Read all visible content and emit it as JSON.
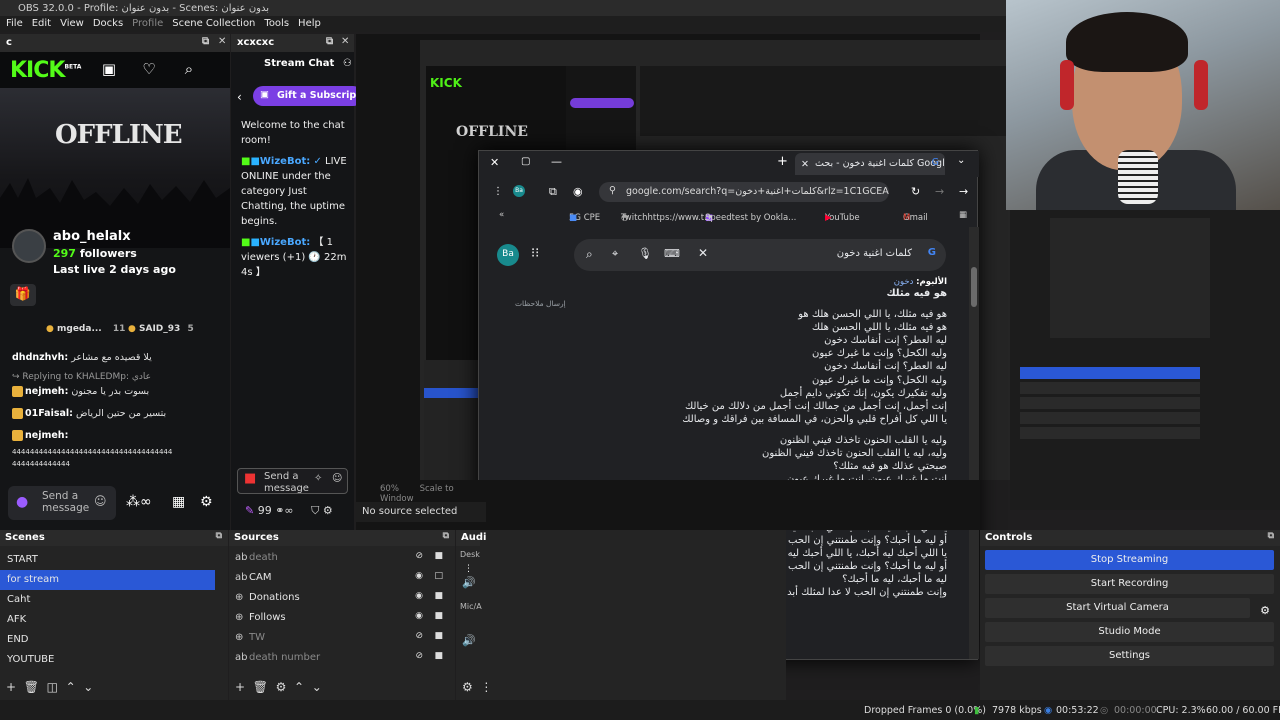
{
  "window": {
    "title": "OBS 32.0.0 - Profile: بدون عنوان - Scenes: بدون عنوان"
  },
  "menu": [
    "File",
    "Edit",
    "View",
    "Docks",
    "Profile",
    "Scene Collection",
    "Tools",
    "Help"
  ],
  "kick_dock": {
    "title": "c",
    "logo": "KICK",
    "logo_sup": "BETA",
    "offline_text": "OFFLINE",
    "streamer": "abo_helalx",
    "followers_count": "297",
    "followers_label": "followers",
    "last_live": "Last live 2 days ago",
    "leaderboard": [
      {
        "name": "mgeda...",
        "count": "11"
      },
      {
        "name": "SAID_93",
        "count": "5"
      }
    ],
    "chat": [
      {
        "user": "dhdnzhvh:",
        "text": "يلا قصيده مع مشاعر"
      },
      {
        "user": "",
        "text": "Replying to KHALEDMp: عادي"
      },
      {
        "user": "nejmeh:",
        "text": "بسوت بدر يا مجنون"
      },
      {
        "user": "01Faisal:",
        "text": "بتسير من حتين الرياض"
      },
      {
        "user": "nejmeh:",
        "text": ""
      },
      {
        "user": "",
        "text": "444444444444444444444444444444444444"
      },
      {
        "user": "",
        "text": "4444444444444"
      }
    ],
    "input_placeholder": "Send a message"
  },
  "xc_dock": {
    "title": "xcxcxc",
    "chat_title": "Stream Chat",
    "gift_label": "Gift a Subscripti",
    "welcome": "Welcome to the chat room!",
    "bot1": "WizeBot:",
    "msg1": "LIVE ONLINE under the category Just Chatting, the uptime begins.",
    "bot2": "WizeBot:",
    "msg2": "【 1 viewers (+1) 🕐 22m 4s 】",
    "input_placeholder": "Send a message",
    "points": "99"
  },
  "chrome": {
    "tab_title": "كلمات اغنية دخون - بحث Google",
    "address": "google.com/search?q=كلمات+اغنية+دخون&rlz=1C1GCEA_...",
    "bookmarks": [
      "5G CPE",
      "Twitchhttps://www.t...",
      "Speedtest by Ookla...",
      "YouTube",
      "Gmail"
    ],
    "avatar": "Ba",
    "search_text": "كلمات اغنية دخون",
    "album_label": "الألبوم:",
    "album_value": "دخون",
    "feedback": "إرسال ملاحظات",
    "lyrics": [
      "هو فيه مثلك",
      "",
      "هو فيه مثلك، يا اللي الحسن هلك هو",
      "هو فيه مثلك، يا اللي الحسن هلك",
      "ليه العطر؟ إنت أنفاسك دخون",
      "وليه الكحل؟ وإنت ما غيرك عيون",
      "ليه العطر؟ إنت أنفاسك دخون",
      "وليه الكحل؟ وإنت ما غيرك عيون",
      "وليه تفكيرك يكون، إنك تكوني دايم أجمل",
      "إنت أجمل، إنت أجمل من جمالك إنت أجمل من دلالك من خيالك",
      "يا اللي كل أفراح قلبي والحزن، في المسافة بين فراقك و وصالك",
      "",
      "وليه يا القلب الحنون تاخذك فيني الظنون",
      "وليه، ليه يا القلب الحنون تاخذك فيني الظنون",
      "صبحتي عذلك هو فيه مثلك؟",
      "إنت ما غيرك عيون، إنت ما غيرك عيون",
      "وأنا أحبك، أحبك، أحبك وإنت، وإنت أنفاسك دخون",
      "وإنت أنفاسك دخون، وإنت أنفاسك دخون",
      "",
      "يا اللي أحبك ليه أحبك، يا اللي أحبك ليه أحبك؟",
      "أو ليه ما أحبك؟ وإنت طمنتني إن الحب كله أسئلة، أسئلة ما تنتهي",
      "يا اللي أحبك ليه أحبك، يا اللي أحبك ليه أحبك؟",
      "أو ليه ما أحبك؟ وإنت طمنتني إن الحب كله أسئلة، أسئلة ما تنتهي",
      "ليه ما أحبك، ليه ما أحبك؟",
      "وإنت طمنتني إن الحب لا عدا لمثلك أبد ما ينتهي"
    ]
  },
  "preview": {
    "zoom": "60%",
    "scale": "Scale to Window",
    "no_source": "No source selected"
  },
  "scenes": {
    "title": "Scenes",
    "items": [
      "START",
      "for stream",
      "Caht",
      "AFK",
      "END",
      "YOUTUBE"
    ],
    "selected": 1
  },
  "sources": {
    "title": "Sources",
    "items": [
      {
        "name": "death",
        "visible": false
      },
      {
        "name": "CAM",
        "visible": true
      },
      {
        "name": "Donations",
        "visible": true
      },
      {
        "name": "Follows",
        "visible": true
      },
      {
        "name": "TW",
        "visible": false
      },
      {
        "name": "death number",
        "visible": false
      }
    ]
  },
  "audio": {
    "title": "Audi",
    "labels": [
      "Desk",
      "Mic/A"
    ]
  },
  "controls": {
    "title": "Controls",
    "buttons": [
      "Stop Streaming",
      "Start Recording",
      "Start Virtual Camera",
      "Studio Mode",
      "Settings"
    ]
  },
  "status": {
    "dropped": "Dropped Frames 0 (0.0%)",
    "kbps": "7978 kbps",
    "stream_time": "00:53:22",
    "rec_time": "00:00:00",
    "cpu": "CPU: 2.3%",
    "fps": "60.00 / 60.00 FPS"
  },
  "colors": {
    "kick_green": "#53fc18",
    "obs_blue": "#2a58d6",
    "purple": "#7b3fe4"
  }
}
